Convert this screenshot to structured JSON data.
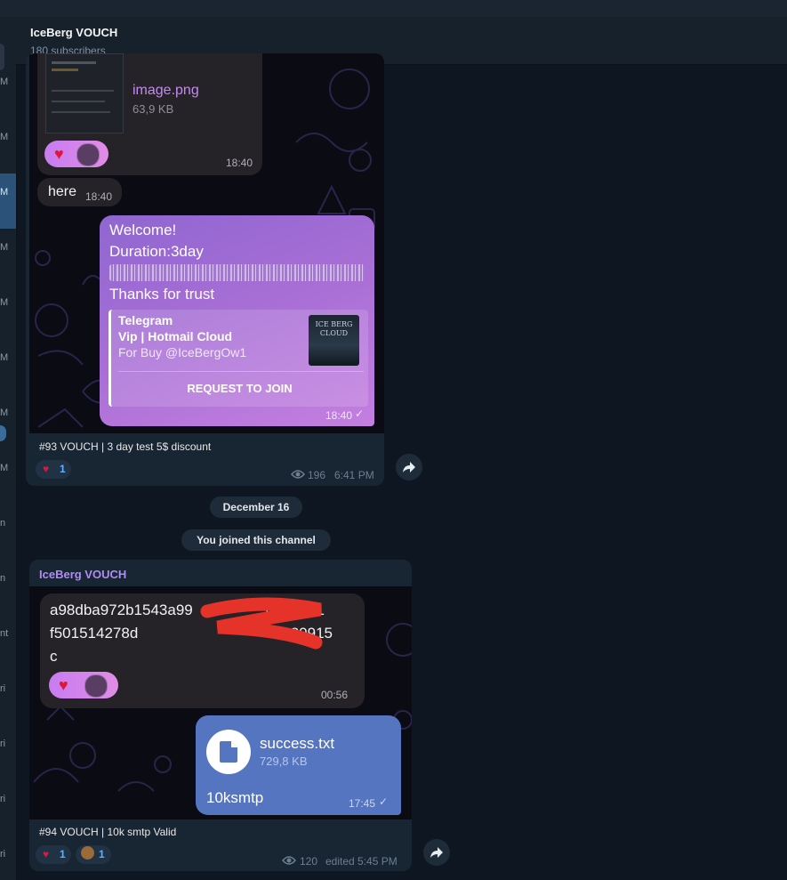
{
  "channel": {
    "title": "IceBerg VOUCH",
    "subscribers": "180 subscribers"
  },
  "sidebar_fragments": [
    "M",
    "M",
    "M",
    "M",
    "M",
    "M",
    "M",
    "M",
    "n",
    "n",
    "nt",
    "ri",
    "ri",
    "ri",
    "ri"
  ],
  "post1": {
    "file": {
      "name": "image.png",
      "size": "63,9 KB",
      "time": "18:40"
    },
    "here_message": {
      "text": "here",
      "time": "18:40"
    },
    "welcome_message": {
      "line1": "Welcome!",
      "line2": "Duration:3day",
      "line4": "Thanks for trust",
      "card": {
        "site": "Telegram",
        "title": "Vip | Hotmail Cloud",
        "desc": "For Buy @IceBergOw1",
        "thumb_text": "ICE BERG CLOUD",
        "button": "REQUEST TO JOIN"
      },
      "time": "18:40"
    },
    "caption": "#93 VOUCH | 3 day test 5$ discount",
    "reactions": [
      {
        "emoji": "❤️",
        "count": "1"
      }
    ],
    "views": "196",
    "time": "6:41 PM"
  },
  "date_separator": "December 16",
  "joined_notice": "You joined this channel",
  "post2": {
    "author": "IceBerg VOUCH",
    "hash_message": {
      "line1": "a98dba972b1543a99",
      "line1_end": "023e1e1",
      "line2": "f501514278d",
      "line2_end": "089915",
      "line3": "c",
      "time": "00:56"
    },
    "file": {
      "name": "success.txt",
      "size": "729,8 KB",
      "caption": "10ksmtp",
      "time": "17:45"
    },
    "caption": "#94 VOUCH | 10k smtp Valid",
    "reactions": [
      {
        "emoji": "❤️",
        "count": "1"
      },
      {
        "emoji": "💩",
        "count": "1"
      }
    ],
    "views": "120",
    "time": "edited 5:45 PM"
  },
  "icons": {
    "views": "eye-icon",
    "share": "share-arrow-icon",
    "file": "document-icon",
    "read": "checkmark-icon"
  },
  "colors": {
    "background": "#0e1621",
    "sidebar": "#17212b",
    "accent": "#5fb0ff",
    "author": "#b18cf5",
    "welcome_bubble": "#a36bd6",
    "file_bubble": "#5575c0"
  }
}
